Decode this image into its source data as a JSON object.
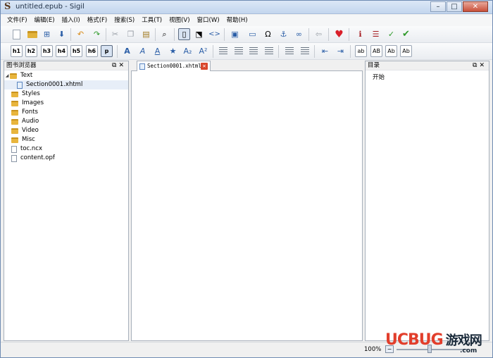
{
  "window": {
    "title": "untitled.epub - Sigil",
    "controls": [
      "–",
      "□",
      "✕"
    ]
  },
  "menu": [
    "文件(F)",
    "编辑(E)",
    "插入(I)",
    "格式(F)",
    "搜索(S)",
    "工具(T)",
    "视图(V)",
    "窗口(W)",
    "帮助(H)"
  ],
  "toolbar2": {
    "headings": [
      "h1",
      "h2",
      "h3",
      "h4",
      "h5",
      "h6",
      "p"
    ],
    "cases": [
      "ab",
      "AB",
      "Ab",
      "Ab"
    ]
  },
  "left_panel": {
    "title": "图书浏览器",
    "tree": [
      {
        "label": "Text",
        "type": "folder",
        "expanded": true
      },
      {
        "label": "Section0001.xhtml",
        "type": "xhtml",
        "selected": true
      },
      {
        "label": "Styles",
        "type": "folder"
      },
      {
        "label": "Images",
        "type": "folder"
      },
      {
        "label": "Fonts",
        "type": "folder"
      },
      {
        "label": "Audio",
        "type": "folder"
      },
      {
        "label": "Video",
        "type": "folder"
      },
      {
        "label": "Misc",
        "type": "folder"
      },
      {
        "label": "toc.ncx",
        "type": "file"
      },
      {
        "label": "content.opf",
        "type": "file"
      }
    ]
  },
  "editor": {
    "tab_label": "Section0001.xhtml"
  },
  "right_panel": {
    "title": "目录",
    "items": [
      "开始"
    ]
  },
  "status": {
    "zoom": "100%"
  },
  "watermark": {
    "brand": "UCBUG",
    "cn": "游戏网",
    "domain": ".com"
  },
  "colors": {
    "accent": "#2b5ea7",
    "close": "#d9472c",
    "folder": "#e8b53d"
  }
}
